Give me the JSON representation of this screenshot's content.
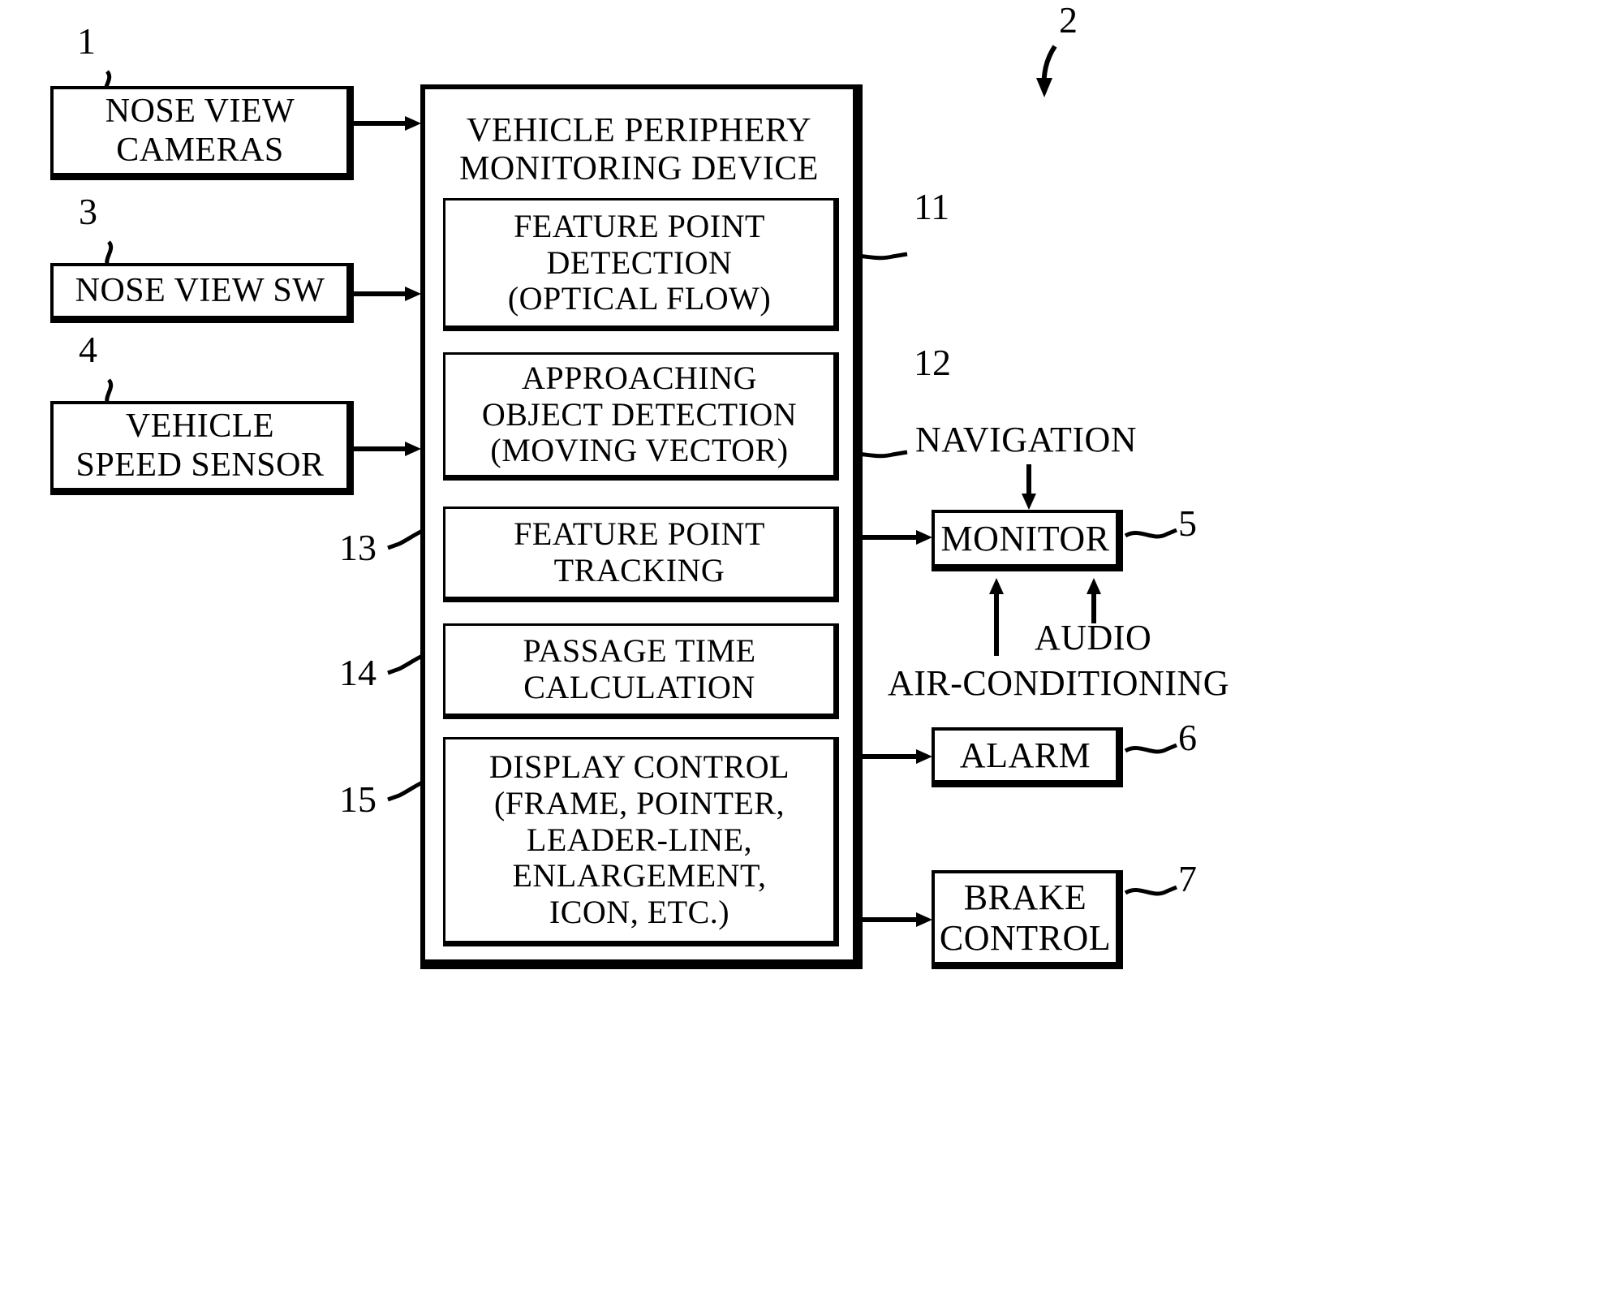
{
  "figure": {
    "type": "block-diagram",
    "domain": "patent-figure",
    "ink_color": "#000000",
    "background_color": "#ffffff"
  },
  "inputs": [
    {
      "ref": "1",
      "label": "NOSE VIEW\nCAMERAS"
    },
    {
      "ref": "3",
      "label": "NOSE VIEW SW"
    },
    {
      "ref": "4",
      "label": "VEHICLE\nSPEED SENSOR"
    }
  ],
  "device": {
    "ref": "2",
    "title": "VEHICLE PERIPHERY\nMONITORING DEVICE",
    "modules": [
      {
        "ref": "11",
        "label": "FEATURE POINT\nDETECTION\n(OPTICAL FLOW)"
      },
      {
        "ref": "12",
        "label": "APPROACHING\nOBJECT DETECTION\n(MOVING VECTOR)"
      },
      {
        "ref": "13",
        "label": "FEATURE POINT\nTRACKING"
      },
      {
        "ref": "14",
        "label": "PASSAGE TIME\nCALCULATION"
      },
      {
        "ref": "15",
        "label": "DISPLAY CONTROL\n(FRAME, POINTER,\nLEADER-LINE,\nENLARGEMENT,\nICON, ETC.)"
      }
    ]
  },
  "outputs": [
    {
      "ref": "5",
      "label": "MONITOR"
    },
    {
      "ref": "6",
      "label": "ALARM"
    },
    {
      "ref": "7",
      "label": "BRAKE\nCONTROL"
    }
  ],
  "monitor_sources": {
    "top": "NAVIGATION",
    "bottom_left": "AIR-CONDITIONING",
    "bottom_right": "AUDIO"
  }
}
